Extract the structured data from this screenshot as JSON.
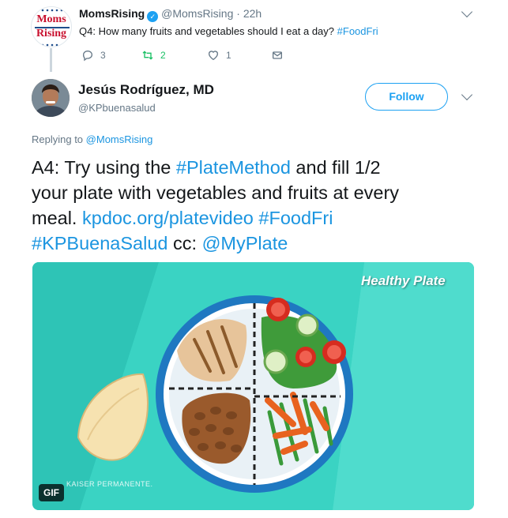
{
  "parent_tweet": {
    "avatar_logo_line1": "Moms",
    "avatar_logo_line2": "Rising",
    "display_name": "MomsRising",
    "handle": "@MomsRising",
    "separator": "·",
    "time": "22h",
    "text_prefix": "Q4: How many fruits and vegetables should I eat a day?",
    "text_hashtag": "#FoodFri",
    "reply_count": "3",
    "retweet_count": "2",
    "like_count": "1"
  },
  "main_tweet": {
    "display_name": "Jesús Rodríguez, MD",
    "handle": "@KPbuenasalud",
    "follow_label": "Follow",
    "replying_prefix": "Replying to",
    "replying_handle": "@MomsRising",
    "body": {
      "l1_a": "A4: Try using the ",
      "l1_b": "#PlateMethod",
      "l1_c": " and fill 1/2",
      "l2": "your plate with vegetables and fruits at every",
      "l3_a": "meal. ",
      "l3_b": "kpdoc.org/platevideo",
      "l3_c": " ",
      "l3_d": "#FoodFri",
      "l4_a": "#KPBuenaSalud",
      "l4_b": " cc: ",
      "l4_c": "@MyPlate"
    },
    "media": {
      "title": "Healthy Plate",
      "watermark": "KAISER PERMANENTE.",
      "badge": "GIF"
    }
  },
  "colors": {
    "link": "#1b95e0",
    "retweet_active": "#17bf63",
    "media_bg": "#34d1c1"
  },
  "icons": [
    "verified-badge-icon",
    "caret-down-icon",
    "reply-icon",
    "retweet-icon",
    "like-icon",
    "share-icon"
  ]
}
